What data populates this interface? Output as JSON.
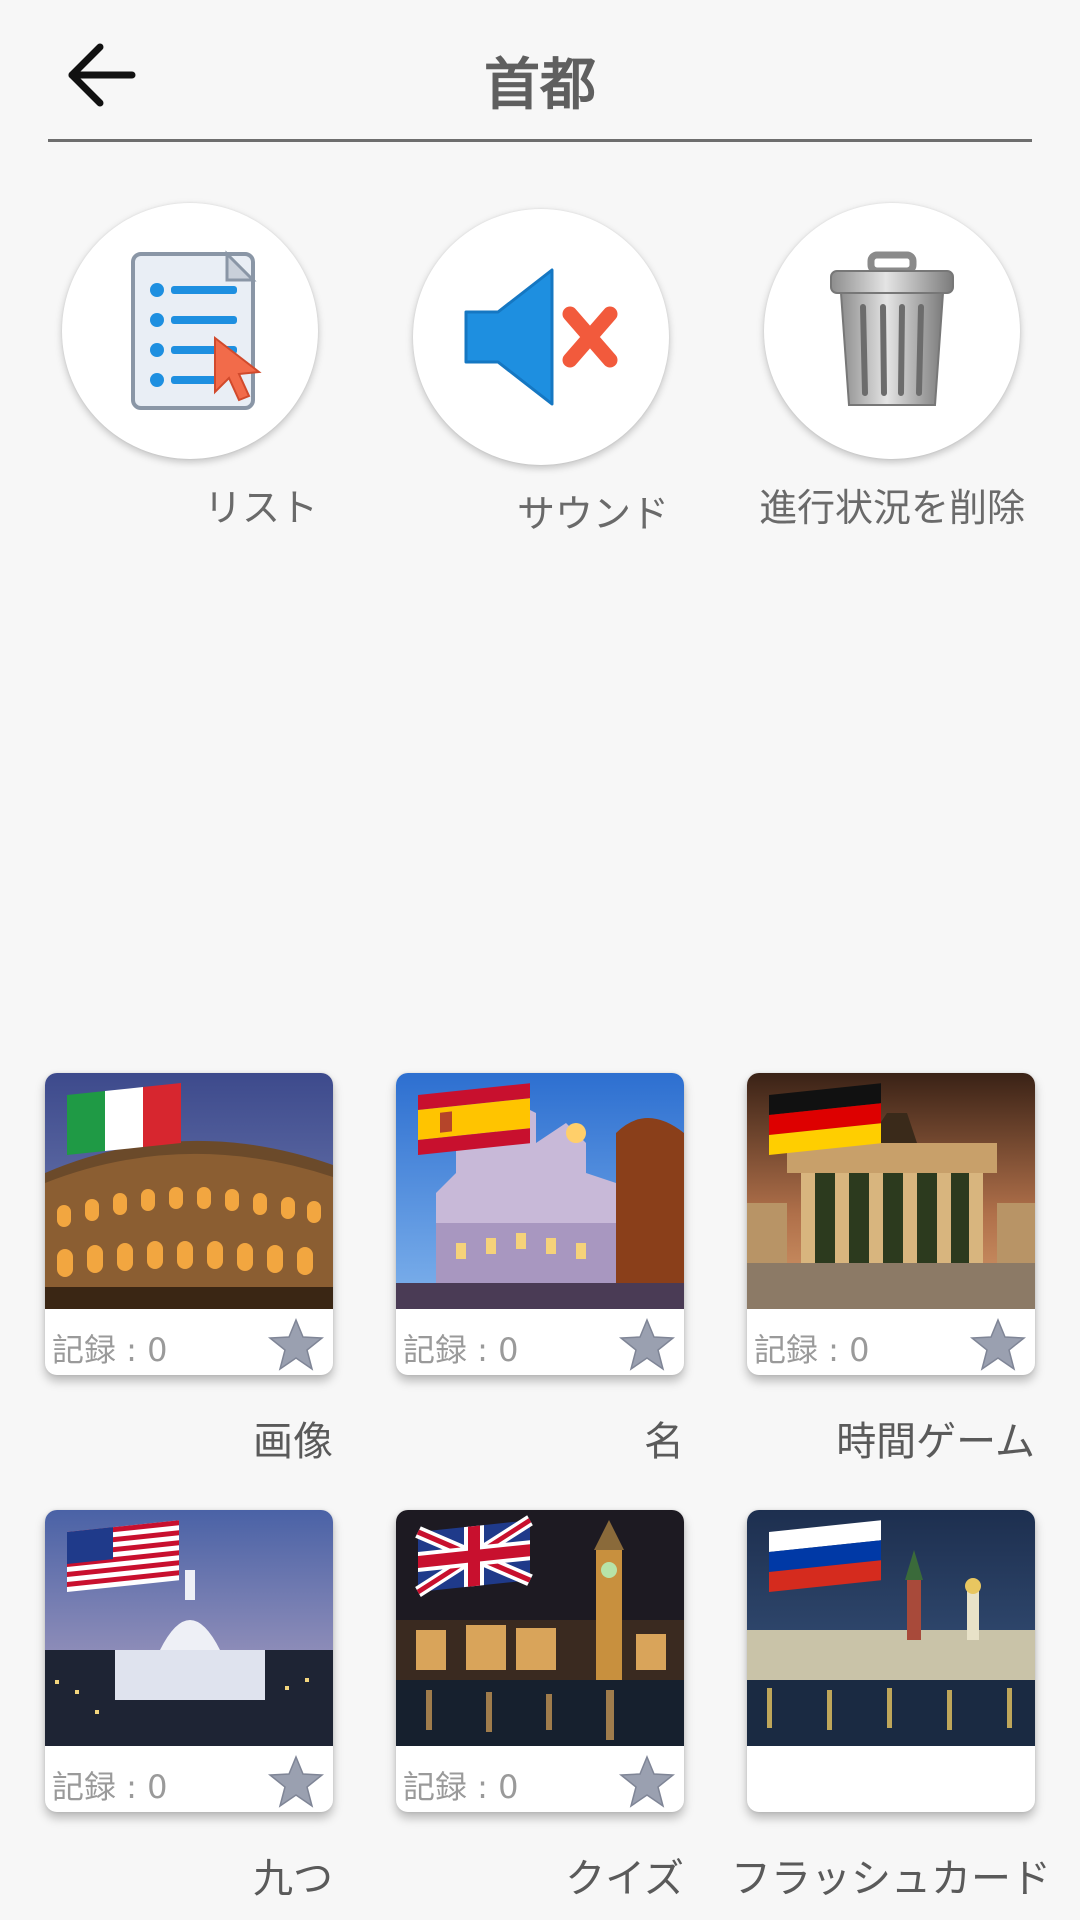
{
  "header": {
    "title": "首都",
    "back_icon": "arrow-left-icon"
  },
  "actions": [
    {
      "label": "リスト",
      "icon": "list-document-icon"
    },
    {
      "label": "サウンド",
      "icon": "sound-muted-icon"
    },
    {
      "label": "進行状況を削除",
      "icon": "trash-can-icon"
    }
  ],
  "modes": [
    {
      "label": "画像",
      "record": "記録 : 0",
      "theme": "italy-colosseum"
    },
    {
      "label": "名",
      "record": "記録 : 0",
      "theme": "spain-madrid"
    },
    {
      "label": "時間ゲーム",
      "record": "記録 : 0",
      "theme": "germany-brandenburg-gate"
    },
    {
      "label": "九つ",
      "record": "記録 : 0",
      "theme": "usa-capitol"
    },
    {
      "label": "クイズ",
      "record": "記録 : 0",
      "theme": "uk-big-ben"
    },
    {
      "label": "フラッシュカード",
      "record": "",
      "theme": "russia-kremlin"
    }
  ],
  "colors": {
    "background": "#f7f7f7",
    "star": "#9aa0b0",
    "speaker": "#1e8fe0",
    "mute_x": "#f25a3c"
  }
}
